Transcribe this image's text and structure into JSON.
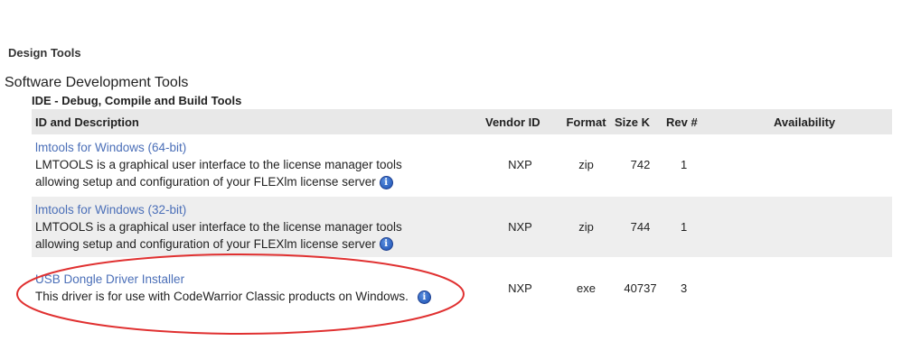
{
  "sections": {
    "design_tools": "Design Tools",
    "software_dev_tools": "Software Development Tools",
    "ide_tools": "IDE - Debug, Compile and Build Tools"
  },
  "table": {
    "headers": {
      "desc": "ID and Description",
      "vendor": "Vendor ID",
      "format": "Format",
      "size": "Size K",
      "rev": "Rev #",
      "availability": "Availability"
    },
    "rows": [
      {
        "title": "lmtools for Windows (64-bit)",
        "desc_line1": "LMTOOLS is a graphical user interface to the license manager tools",
        "desc_line2": "allowing setup and configuration of your FLEXlm license server",
        "vendor": "NXP",
        "format": "zip",
        "size": "742",
        "rev": "1",
        "availability": ""
      },
      {
        "title": "lmtools for Windows (32-bit)",
        "desc_line1": "LMTOOLS is a graphical user interface to the license manager tools",
        "desc_line2": "allowing setup and configuration of your FLEXlm license server",
        "vendor": "NXP",
        "format": "zip",
        "size": "744",
        "rev": "1",
        "availability": ""
      },
      {
        "title": "USB Dongle Driver Installer",
        "desc_line1": "This driver is for use with CodeWarrior Classic products on Windows.",
        "vendor": "NXP",
        "format": "exe",
        "size": "40737",
        "rev": "3",
        "availability": ""
      }
    ]
  },
  "icons": {
    "info": "info-icon",
    "info_glyph": "i"
  },
  "colors": {
    "link": "#4b6fb8",
    "header_bg": "#e8e8e8",
    "row_shade": "#eeeeee",
    "annotation": "#e03030"
  }
}
